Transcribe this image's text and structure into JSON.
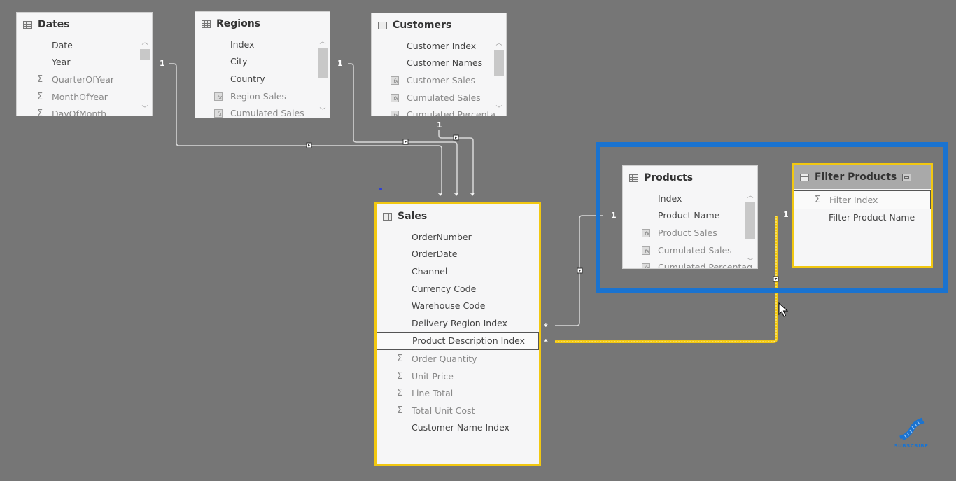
{
  "tables": {
    "dates": {
      "name": "Dates",
      "fields": [
        {
          "label": "Date",
          "icon": ""
        },
        {
          "label": "Year",
          "icon": ""
        },
        {
          "label": "QuarterOfYear",
          "icon": "sigma"
        },
        {
          "label": "MonthOfYear",
          "icon": "sigma"
        },
        {
          "label": "DayOfMonth",
          "icon": "sigma"
        }
      ]
    },
    "regions": {
      "name": "Regions",
      "fields": [
        {
          "label": "Index",
          "icon": ""
        },
        {
          "label": "City",
          "icon": ""
        },
        {
          "label": "Country",
          "icon": ""
        },
        {
          "label": "Region Sales",
          "icon": "measure"
        },
        {
          "label": "Cumulated Sales",
          "icon": "measure"
        }
      ]
    },
    "customers": {
      "name": "Customers",
      "fields": [
        {
          "label": "Customer Index",
          "icon": ""
        },
        {
          "label": "Customer Names",
          "icon": ""
        },
        {
          "label": "Customer Sales",
          "icon": "measure"
        },
        {
          "label": "Cumulated Sales",
          "icon": "measure"
        },
        {
          "label": "Cumulated Percenta",
          "icon": "measure"
        }
      ]
    },
    "sales": {
      "name": "Sales",
      "fields": [
        {
          "label": "OrderNumber",
          "icon": ""
        },
        {
          "label": "OrderDate",
          "icon": ""
        },
        {
          "label": "Channel",
          "icon": ""
        },
        {
          "label": "Currency Code",
          "icon": ""
        },
        {
          "label": "Warehouse Code",
          "icon": ""
        },
        {
          "label": "Delivery Region Index",
          "icon": ""
        },
        {
          "label": "Product Description Index",
          "icon": "",
          "highlighted": true
        },
        {
          "label": "Order Quantity",
          "icon": "sigma"
        },
        {
          "label": "Unit Price",
          "icon": "sigma"
        },
        {
          "label": "Line Total",
          "icon": "sigma"
        },
        {
          "label": "Total Unit Cost",
          "icon": "sigma"
        },
        {
          "label": "Customer Name Index",
          "icon": ""
        }
      ]
    },
    "products": {
      "name": "Products",
      "fields": [
        {
          "label": "Index",
          "icon": ""
        },
        {
          "label": "Product Name",
          "icon": ""
        },
        {
          "label": "Product Sales",
          "icon": "measure"
        },
        {
          "label": "Cumulated Sales",
          "icon": "measure"
        },
        {
          "label": "Cumulated Percentag",
          "icon": "measure"
        }
      ]
    },
    "filter_products": {
      "name": "Filter Products",
      "fields": [
        {
          "label": "Filter Index",
          "icon": "sigma",
          "highlighted": true
        },
        {
          "label": "Filter Product Name",
          "icon": ""
        }
      ]
    }
  },
  "relationships": [
    {
      "from": "Dates",
      "to": "Sales",
      "one_label": "1",
      "many_label": "*"
    },
    {
      "from": "Regions",
      "to": "Sales",
      "one_label": "1",
      "many_label": "*"
    },
    {
      "from": "Customers",
      "to": "Sales",
      "one_label": "1",
      "many_label": "*"
    },
    {
      "from": "Products",
      "to": "Sales",
      "one_label": "1",
      "many_label": "*"
    },
    {
      "from": "Filter Products",
      "to": "Sales",
      "one_label": "1",
      "many_label": "*",
      "selected": true
    }
  ],
  "icons": {
    "sigma": "Σ",
    "table": "table-icon",
    "measure": "fx"
  },
  "colors": {
    "canvas": "#767676",
    "selection": "#f2c811",
    "highlight_box": "#1a73d0"
  },
  "logo": {
    "label": "SUBSCRIBE"
  }
}
